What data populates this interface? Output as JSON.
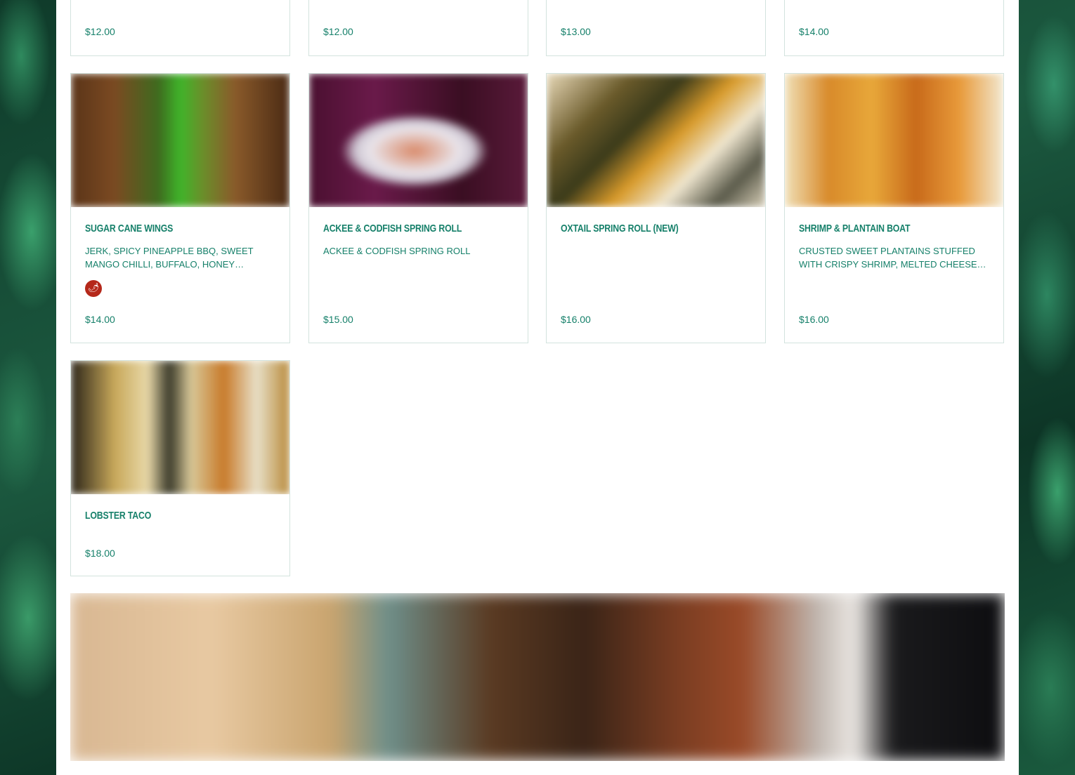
{
  "top_row": [
    {
      "price": "$12.00"
    },
    {
      "price": "$12.00"
    },
    {
      "price": "$13.00"
    },
    {
      "price": "$14.00"
    }
  ],
  "items": [
    {
      "name": "SUGAR CANE WINGS",
      "description": "JERK, SPICY PINEAPPLE BBQ, SWEET MANGO CHILLI, BUFFALO, HONEY…",
      "price": "$14.00",
      "spicy": true,
      "icon": "chili-pepper-icon"
    },
    {
      "name": "ACKEE & CODFISH SPRING ROLL",
      "description": "ACKEE & CODFISH SPRING ROLL",
      "price": "$15.00"
    },
    {
      "name": "OXTAIL SPRING ROLL (NEW)",
      "description": "",
      "price": "$16.00"
    },
    {
      "name": "SHRIMP & PLANTAIN BOAT",
      "description": "CRUSTED SWEET PLANTAINS STUFFED WITH CRISPY SHRIMP, MELTED CHEESE…",
      "price": "$16.00"
    },
    {
      "name": "LOBSTER TACO",
      "description": "",
      "price": "$18.00"
    }
  ],
  "colors": {
    "accent": "#16806a",
    "spicy_badge": "#b5281a",
    "card_border": "#d3e3de"
  }
}
